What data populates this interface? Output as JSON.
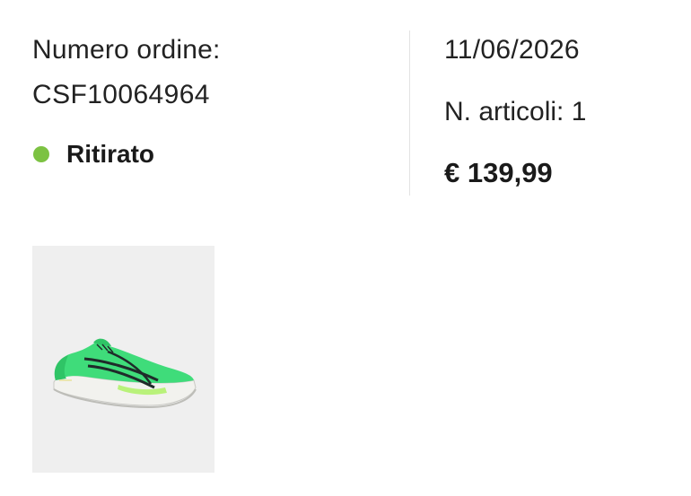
{
  "order": {
    "number_label": "Numero ordine:",
    "number": "CSF10064964",
    "status": "Ritirato",
    "date": "11/06/2026",
    "items_count": "N. articoli: 1",
    "total": "€ 139,99"
  },
  "colors": {
    "status_green": "#7cc242",
    "shoe_upper": "#3fdc7a",
    "shoe_stripe": "#1f2b2a",
    "shoe_sole": "#f2f2ee",
    "thumb_background": "#efefef"
  },
  "product": {
    "image": "running-shoe-image"
  }
}
